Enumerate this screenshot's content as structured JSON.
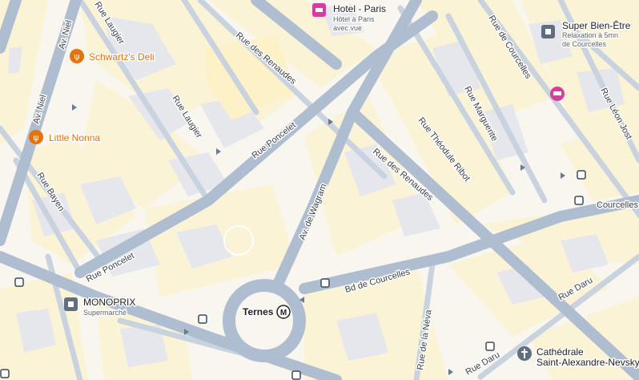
{
  "colors": {
    "land": "#f8f6ee",
    "block": "#fbf3d6",
    "building": "#e8e8ec",
    "road": "#aebdd0",
    "road_minor": "#c7d2de",
    "food": "#e8710a",
    "hotel": "#d93ca0",
    "shop": "#5f6e80",
    "church": "#5f6e80"
  },
  "streets": {
    "av_niel_top": "Av. Niel",
    "av_niel_left": "Av. Niel",
    "rue_laugier_top": "Rue Laugier",
    "rue_laugier_mid": "Rue Laugier",
    "rue_des_renaudes_top": "Rue des Renaudes",
    "rue_des_renaudes_mid": "Rue des Renaudes",
    "rue_poncelet_mid": "Rue Poncelet",
    "rue_poncelet_low": "Rue Poncelet",
    "rue_bayen": "Rue Bayen",
    "av_de_wagram": "Av. de Wagram",
    "rue_theodule_ribot": "Rue Théodule Ribot",
    "rue_marguerite": "Rue Marguerite",
    "rue_de_courcelles": "Rue de Courcelles",
    "rue_leon_jost": "Rue Léon Jost",
    "bd_de_courcelles": "Bd de Courcelles",
    "rue_de_la_neva": "Rue de la Néva",
    "rue_daru_right": "Rue Daru",
    "rue_daru_bottom": "Rue Daru",
    "courcelles_edge": "Courcelles"
  },
  "pois": {
    "schwartzs_deli": {
      "name": "Schwartz's Deli",
      "icon": "restaurant-icon"
    },
    "little_nonna": {
      "name": "Little Nonna",
      "icon": "restaurant-icon"
    },
    "hotel_paris": {
      "name": "Hotel - Paris",
      "sub1": "Hôtel à Paris",
      "sub2": "avec vue",
      "icon": "hotel-icon"
    },
    "hotel_unnamed": {
      "icon": "hotel-icon"
    },
    "super_bien_etre": {
      "name": "Super Bien-Être",
      "sub1": "Relaxation à 5mn",
      "sub2": "de Courcelles",
      "icon": "spa-icon"
    },
    "monoprix": {
      "name": "MONOPRIX",
      "sub1": "Supermarché",
      "icon": "shop-icon"
    },
    "cathedrale": {
      "name": "Cathédrale",
      "name2": "Saint-Alexandre-Nevsky",
      "icon": "church-icon"
    },
    "ternes": {
      "name": "Ternes",
      "metro_letter": "M",
      "icon": "metro-icon"
    }
  },
  "bus_symbol": "▢"
}
